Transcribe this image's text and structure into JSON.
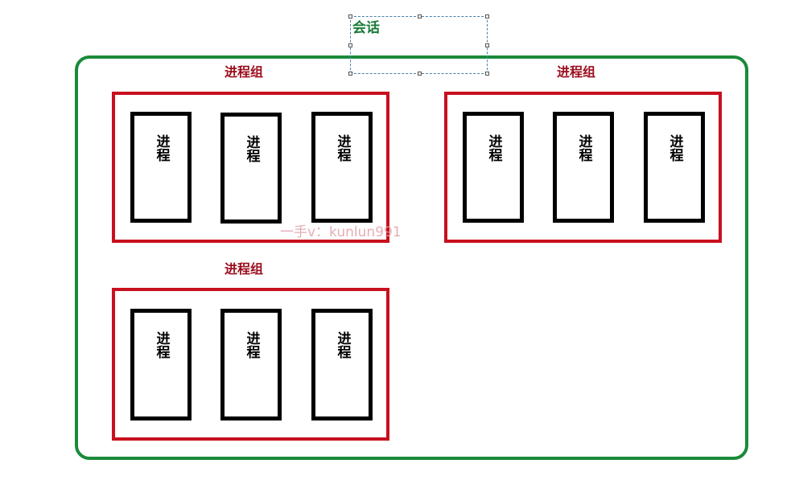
{
  "session": {
    "title": "会话"
  },
  "groups": [
    {
      "title": "进程组",
      "processes": [
        "进程",
        "进程",
        "进程"
      ]
    },
    {
      "title": "进程组",
      "processes": [
        "进程",
        "进程",
        "进程"
      ]
    },
    {
      "title": "进程组",
      "processes": [
        "进程",
        "进程",
        "进程"
      ]
    }
  ],
  "watermark": "一手v：kunlun991",
  "colors": {
    "session_border": "#1a8a3a",
    "session_title": "#1a7a3a",
    "group_border": "#c8101e",
    "group_title": "#9b0c1c",
    "process_border": "#000000"
  }
}
